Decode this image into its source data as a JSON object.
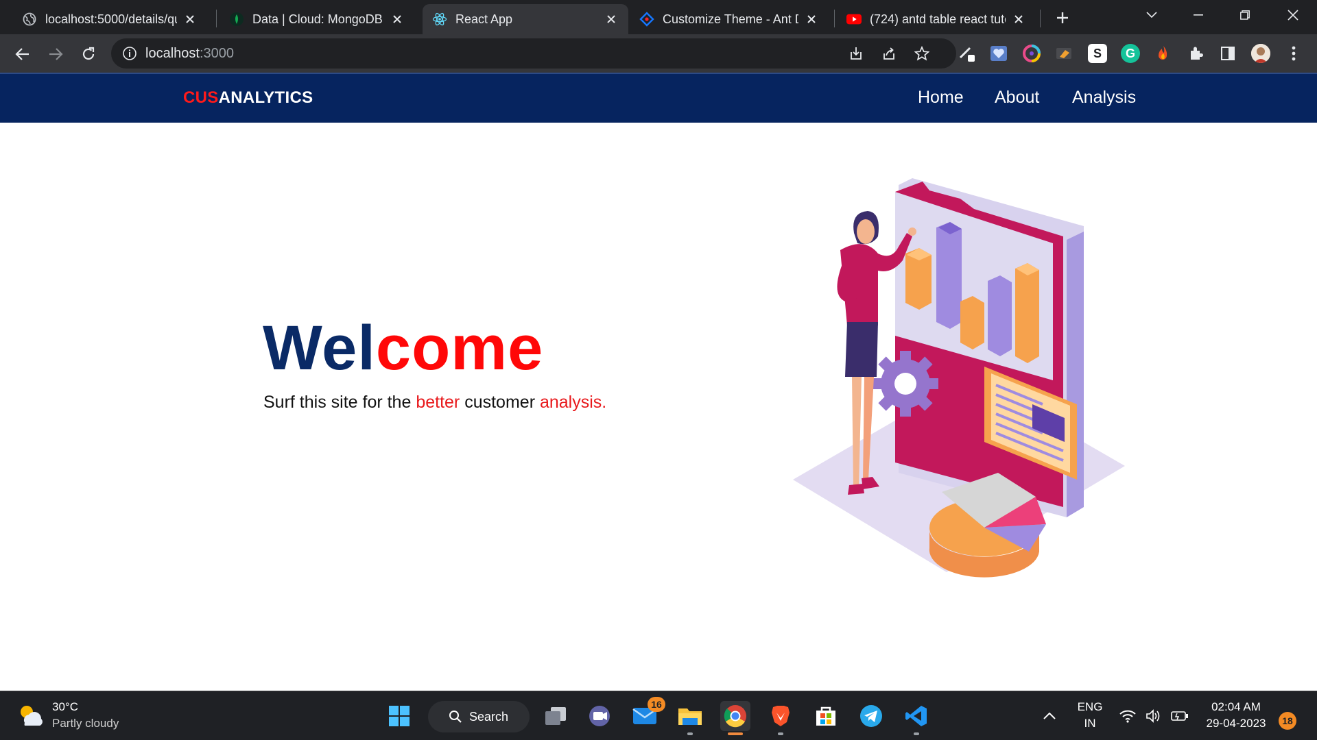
{
  "browser": {
    "tabs": [
      {
        "title": "localhost:5000/details/qu",
        "icon": "globe-icon"
      },
      {
        "title": "Data | Cloud: MongoDB C",
        "icon": "mongodb-leaf-icon"
      },
      {
        "title": "React App",
        "icon": "react-icon"
      },
      {
        "title": "Customize Theme - Ant D",
        "icon": "ant-design-icon"
      },
      {
        "title": "(724) antd table react tuto",
        "icon": "youtube-icon"
      }
    ],
    "active_tab": 2,
    "url_host": "localhost",
    "url_port": ":3000"
  },
  "app": {
    "brand_cus": "CUS",
    "brand_rest": "ANALYTICS",
    "nav": [
      "Home",
      "About",
      "Analysis"
    ],
    "hero": {
      "title_a": "Wel",
      "title_b": "come",
      "sub_1": "Surf this site for the ",
      "sub_2": "better",
      "sub_3": " customer ",
      "sub_4": "analysis."
    }
  },
  "taskbar": {
    "temperature": "30°C",
    "condition": "Partly cloudy",
    "search_label": "Search",
    "mail_badge": "16",
    "lang_1": "ENG",
    "lang_2": "IN",
    "time": "02:04 AM",
    "date": "29-04-2023",
    "notifications": "18"
  },
  "colors": {
    "nav_bg": "#06245f",
    "brand_red": "#ff1a1a",
    "title_navy": "#0a2a66",
    "title_red": "#ff0808"
  }
}
